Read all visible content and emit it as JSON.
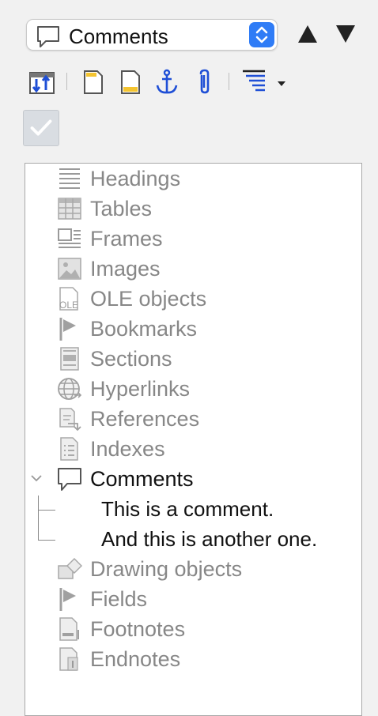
{
  "navigator": {
    "category_select": {
      "value": "Comments",
      "icon": "comment-icon"
    },
    "prev_label": "▲",
    "next_label": "▼"
  },
  "toolbar": {
    "buttons": [
      {
        "name": "toggle-button",
        "icon": "toggle-navigator-icon"
      },
      {
        "name": "header-button",
        "icon": "header-page-icon"
      },
      {
        "name": "footer-button",
        "icon": "footer-page-icon"
      },
      {
        "name": "anchor-button",
        "icon": "anchor-icon"
      },
      {
        "name": "reminder-button",
        "icon": "paperclip-icon"
      },
      {
        "name": "heading-levels-button",
        "icon": "outline-levels-icon"
      }
    ],
    "track_changes_check": "✓"
  },
  "tree": {
    "items": [
      {
        "label": "Headings",
        "icon": "headings-icon",
        "state": "inactive"
      },
      {
        "label": "Tables",
        "icon": "table-icon",
        "state": "inactive"
      },
      {
        "label": "Frames",
        "icon": "frame-icon",
        "state": "inactive"
      },
      {
        "label": "Images",
        "icon": "image-icon",
        "state": "inactive"
      },
      {
        "label": "OLE objects",
        "icon": "ole-icon",
        "state": "inactive"
      },
      {
        "label": "Bookmarks",
        "icon": "bookmark-flag-icon",
        "state": "inactive"
      },
      {
        "label": "Sections",
        "icon": "section-icon",
        "state": "inactive"
      },
      {
        "label": "Hyperlinks",
        "icon": "globe-icon",
        "state": "inactive"
      },
      {
        "label": "References",
        "icon": "reference-icon",
        "state": "inactive"
      },
      {
        "label": "Indexes",
        "icon": "index-icon",
        "state": "inactive"
      },
      {
        "label": "Comments",
        "icon": "comment-icon",
        "state": "expanded",
        "children": [
          "This is a comment.",
          "And this is another one."
        ]
      },
      {
        "label": "Drawing objects",
        "icon": "drawing-icon",
        "state": "inactive"
      },
      {
        "label": "Fields",
        "icon": "field-flag-icon",
        "state": "inactive"
      },
      {
        "label": "Footnotes",
        "icon": "footnote-icon",
        "state": "inactive"
      },
      {
        "label": "Endnotes",
        "icon": "endnote-icon",
        "state": "inactive"
      }
    ]
  },
  "colors": {
    "accent": "#2f7cf6",
    "icon_blue": "#1f4fd6",
    "inactive_text": "#878787"
  }
}
